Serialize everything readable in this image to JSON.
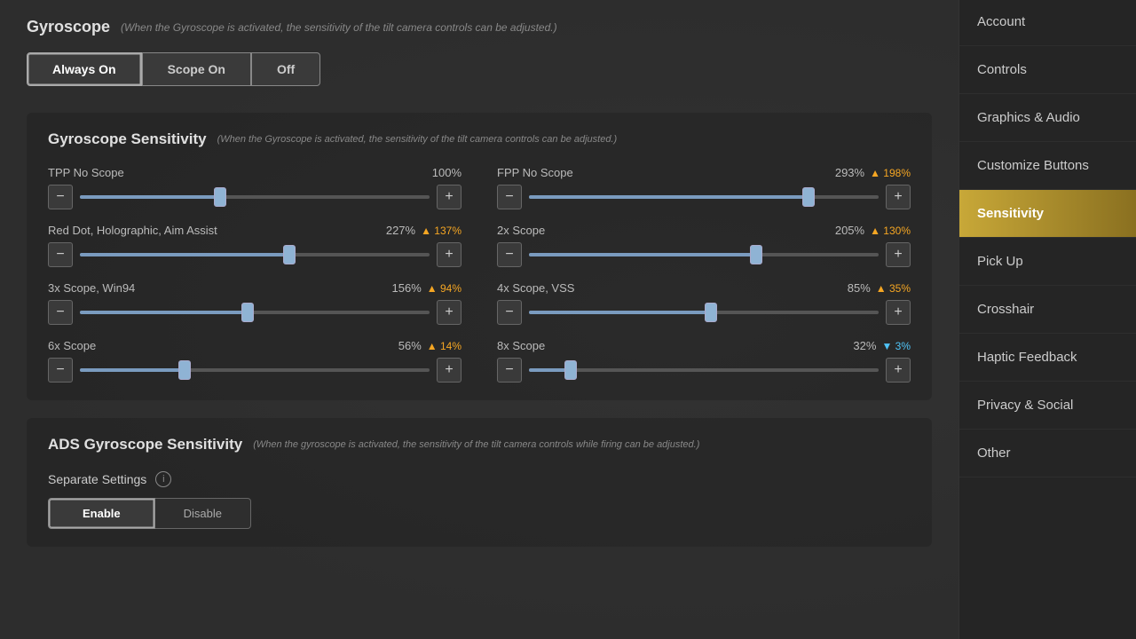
{
  "gyroscope": {
    "title": "Gyroscope",
    "subtitle": "(When the Gyroscope is activated, the sensitivity of the tilt camera controls can be adjusted.)",
    "buttons": [
      "Always On",
      "Scope On",
      "Off"
    ],
    "active_button": 0
  },
  "gyroscope_sensitivity": {
    "title": "Gyroscope Sensitivity",
    "subtitle": "(When the Gyroscope is activated, the sensitivity of the tilt camera controls can be adjusted.)",
    "sliders": [
      {
        "label": "TPP No Scope",
        "value": "100%",
        "delta": null,
        "delta_dir": null,
        "fill_pct": 40
      },
      {
        "label": "FPP No Scope",
        "value": "293%",
        "delta": "198%",
        "delta_dir": "up",
        "fill_pct": 80
      },
      {
        "label": "Red Dot, Holographic, Aim Assist",
        "value": "227%",
        "delta": "137%",
        "delta_dir": "up",
        "fill_pct": 60
      },
      {
        "label": "2x Scope",
        "value": "205%",
        "delta": "130%",
        "delta_dir": "up",
        "fill_pct": 65
      },
      {
        "label": "3x Scope, Win94",
        "value": "156%",
        "delta": "94%",
        "delta_dir": "up",
        "fill_pct": 48
      },
      {
        "label": "4x Scope, VSS",
        "value": "85%",
        "delta": "35%",
        "delta_dir": "up",
        "fill_pct": 52
      },
      {
        "label": "6x Scope",
        "value": "56%",
        "delta": "14%",
        "delta_dir": "up",
        "fill_pct": 30
      },
      {
        "label": "8x Scope",
        "value": "32%",
        "delta": "3%",
        "delta_dir": "down",
        "fill_pct": 12
      }
    ]
  },
  "ads_sensitivity": {
    "title": "ADS Gyroscope Sensitivity",
    "subtitle": "(When the gyroscope is activated, the sensitivity of the tilt camera controls while firing can be adjusted.)",
    "separate_settings_label": "Separate Settings",
    "enable_label": "Enable",
    "disable_label": "Disable"
  },
  "sidebar": {
    "items": [
      {
        "label": "Account",
        "active": false
      },
      {
        "label": "Controls",
        "active": false
      },
      {
        "label": "Graphics & Audio",
        "active": false
      },
      {
        "label": "Customize Buttons",
        "active": false
      },
      {
        "label": "Sensitivity",
        "active": true
      },
      {
        "label": "Pick Up",
        "active": false
      },
      {
        "label": "Crosshair",
        "active": false
      },
      {
        "label": "Haptic Feedback",
        "active": false
      },
      {
        "label": "Privacy & Social",
        "active": false
      },
      {
        "label": "Other",
        "active": false
      }
    ]
  }
}
